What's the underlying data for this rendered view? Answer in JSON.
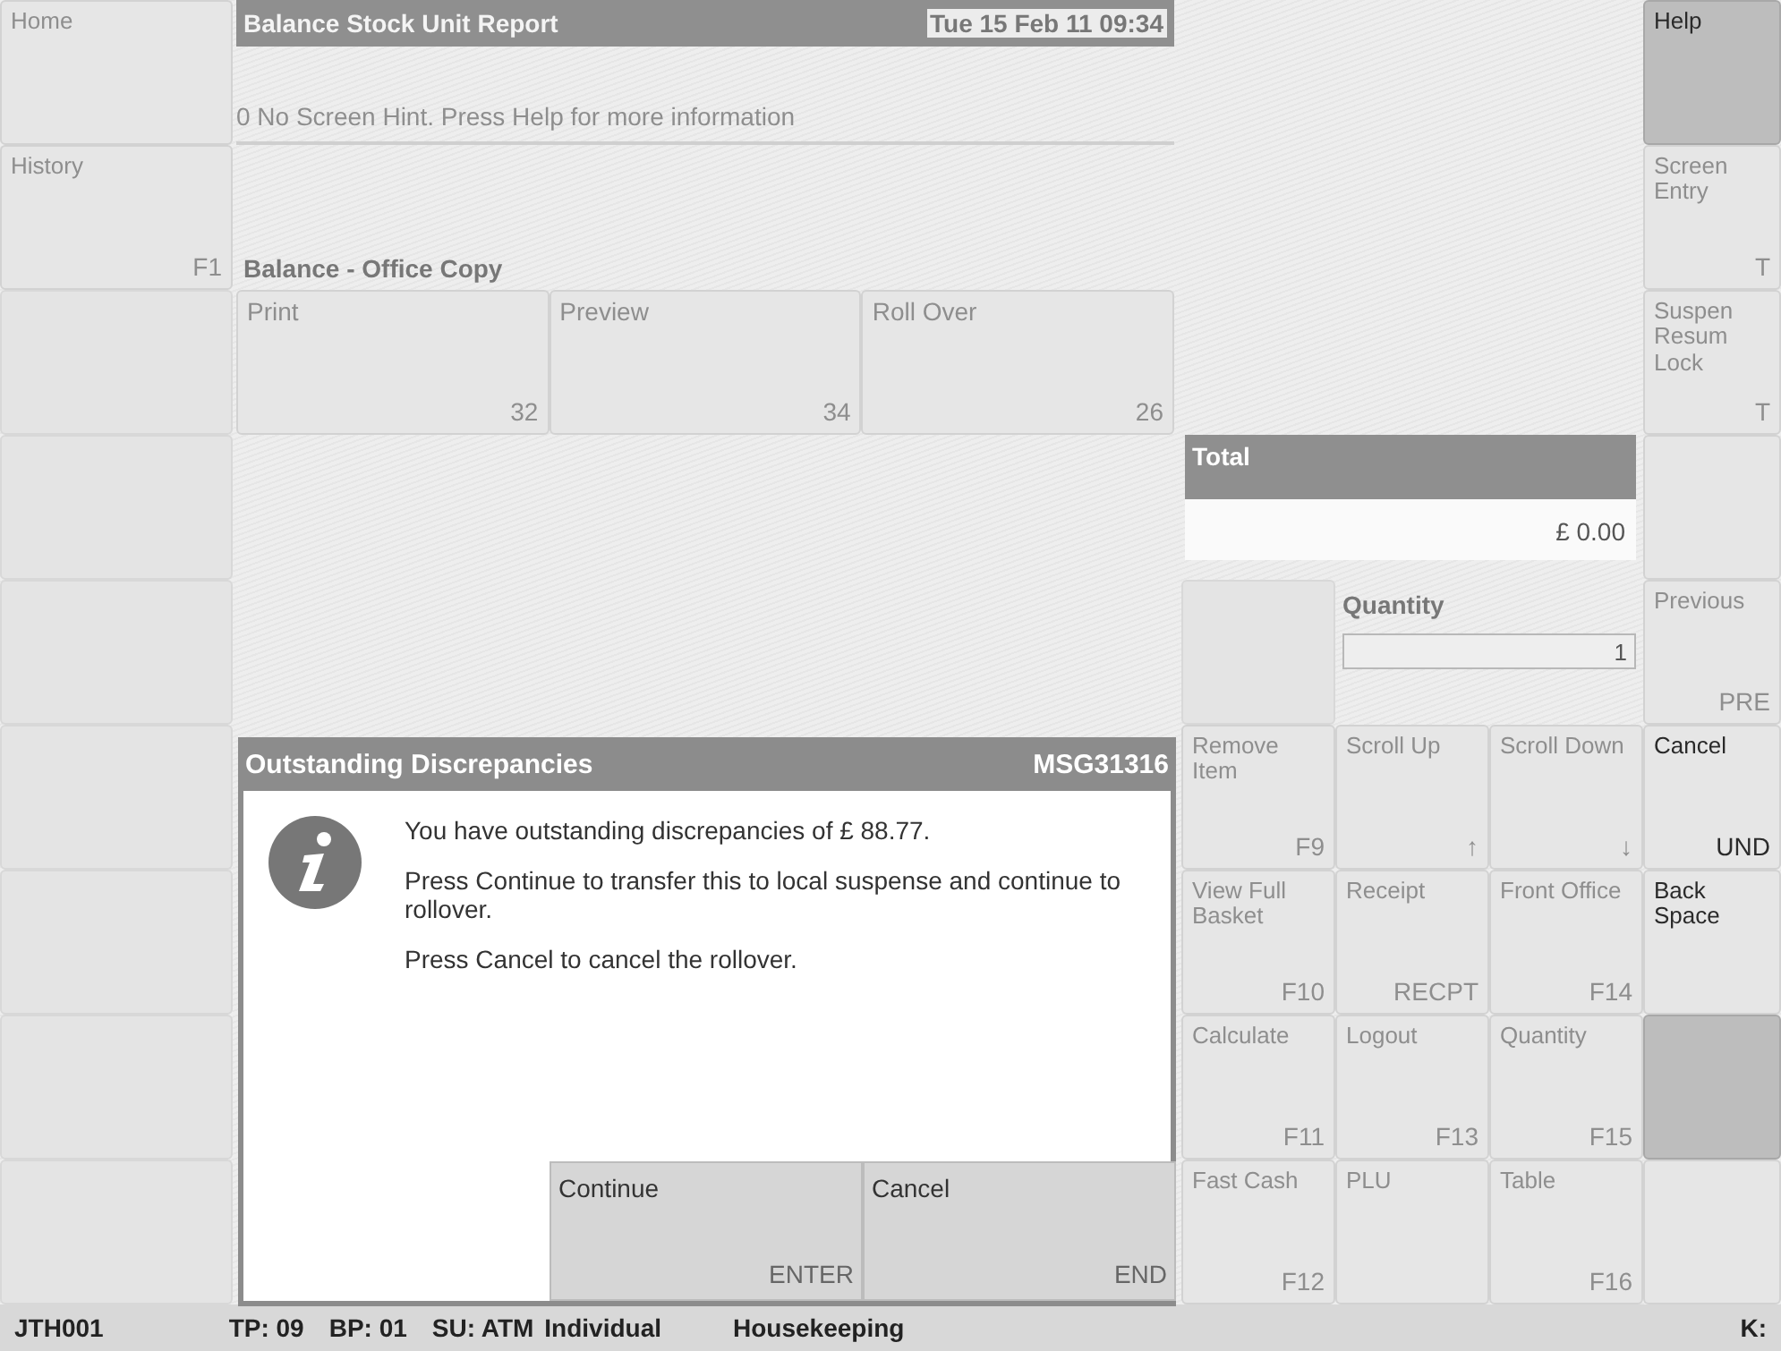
{
  "left_keys": [
    {
      "label": "Home",
      "disabled": true
    },
    {
      "label": "History",
      "key_code": "F1",
      "disabled": true
    }
  ],
  "header": {
    "title": "Balance Stock Unit Report",
    "datetime": "Tue 15 Feb 11 09:34",
    "hint": "0 No Screen Hint. Press Help for more information"
  },
  "section_label": "Balance - Office Copy",
  "report_buttons": [
    {
      "label": "Print",
      "key_code": "32",
      "disabled": true
    },
    {
      "label": "Preview",
      "key_code": "34",
      "disabled": true
    },
    {
      "label": "Roll Over",
      "key_code": "26",
      "disabled": true
    }
  ],
  "total": {
    "label": "Total",
    "value": "£ 0.00"
  },
  "quantity": {
    "label": "Quantity",
    "value": "1"
  },
  "keypad": [
    {
      "label": "Remove Item",
      "key_code": "F9",
      "disabled": true
    },
    {
      "label": "Scroll Up",
      "key_code": "↑",
      "disabled": true
    },
    {
      "label": "Scroll Down",
      "key_code": "↓",
      "disabled": true
    },
    {
      "label": "View Full Basket",
      "key_code": "F10",
      "disabled": true
    },
    {
      "label": "Receipt",
      "key_code": "RECPT",
      "disabled": true
    },
    {
      "label": "Front Office",
      "key_code": "F14",
      "disabled": true
    },
    {
      "label": "Calculate",
      "key_code": "F11",
      "disabled": true
    },
    {
      "label": "Logout",
      "key_code": "F13",
      "disabled": true
    },
    {
      "label": "Quantity",
      "key_code": "F15",
      "disabled": true
    },
    {
      "label": "Fast Cash",
      "key_code": "F12",
      "disabled": true
    },
    {
      "label": "PLU",
      "disabled": true
    },
    {
      "label": "Table",
      "key_code": "F16",
      "disabled": true
    }
  ],
  "right_keys": [
    {
      "label": "Help",
      "disabled": false,
      "shaded": true
    },
    {
      "label": "Screen Entry",
      "key_code": "T",
      "disabled": true,
      "shaded": false
    },
    {
      "label": "Suspen Resum Lock",
      "key_code": "T",
      "disabled": true,
      "shaded": false
    },
    {
      "shaded": false
    },
    {
      "label": "Previous",
      "key_code": "PRE",
      "disabled": true,
      "shaded": false
    },
    {
      "label": "Cancel",
      "key_code": "UND",
      "disabled": false,
      "shaded": false
    },
    {
      "label": "Back Space",
      "disabled": false,
      "shaded": false
    },
    {
      "shaded": true
    },
    {
      "shaded": false
    }
  ],
  "dialog": {
    "title": "Outstanding Discrepancies",
    "code": "MSG31316",
    "paragraphs": [
      "You have outstanding discrepancies of £ 88.77.",
      "Press Continue to transfer this to local suspense and continue to rollover.",
      "Press Cancel to cancel the rollover."
    ],
    "buttons": [
      {
        "label": "Continue",
        "key_code": "ENTER"
      },
      {
        "label": "Cancel",
        "key_code": "END"
      }
    ]
  },
  "status_bar": [
    "JTH001",
    "TP: 09",
    "BP: 01",
    "SU: ATM",
    "Individual",
    "Housekeeping",
    "K:"
  ]
}
